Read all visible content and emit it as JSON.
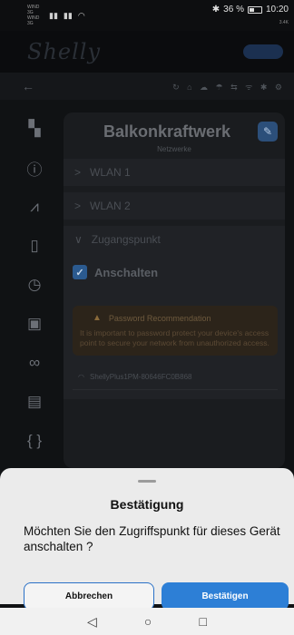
{
  "status_bar": {
    "carrier_line1": "WIND 3G",
    "carrier_line2": "WIND 3G",
    "signal1": "▮▮",
    "signal2": "▮▮",
    "wifi": "◠",
    "bluetooth": "✱",
    "battery_percent": "36 %",
    "time": "10:20",
    "sub_info": "3.4K"
  },
  "app": {
    "logo_text": "Shelly",
    "back_icon": "arrow-left-icon"
  },
  "subbar": {
    "back_glyph": "←",
    "icons_text": "↻ ⌂ ☁ ☂ ⇆ ᯤ ✱ ⚙"
  },
  "sidebar": {
    "items": [
      {
        "icon": "device-icon",
        "glyph": "▚"
      },
      {
        "icon": "info-icon",
        "glyph": "ⓘ"
      },
      {
        "icon": "chart-icon",
        "glyph": "⩘"
      },
      {
        "icon": "battery-icon",
        "glyph": "▯"
      },
      {
        "icon": "clock-icon",
        "glyph": "◷"
      },
      {
        "icon": "calendar-icon",
        "glyph": "▣"
      },
      {
        "icon": "link-icon",
        "glyph": "∞"
      },
      {
        "icon": "plugin-icon",
        "glyph": "▤"
      },
      {
        "icon": "code-icon",
        "glyph": "{ }"
      }
    ]
  },
  "content": {
    "title": "Balkonkraftwerk",
    "subtitle": "Netzwerke",
    "edit_glyph": "✎",
    "sections": [
      {
        "label": "WLAN 1",
        "chevron": ">"
      },
      {
        "label": "WLAN 2",
        "chevron": ">"
      }
    ],
    "open_section": {
      "label": "Zugangspunkt",
      "chevron": "∨",
      "toggle_label": "Anschalten",
      "toggle_glyph": "✓",
      "warning_title": "Password Recommendation",
      "warning_icon_glyph": "▲",
      "warning_text": "It is important to password protect your device's access point to secure your network from unauthorized access.",
      "ssid": "ShellyPlus1PM-80646FC0B868",
      "ssid_icon_glyph": "◠"
    }
  },
  "dialog": {
    "title": "Bestätigung",
    "message": "Möchten Sie den Zugriffspunkt für dieses Gerät anschalten ?",
    "cancel_label": "Abbrechen",
    "confirm_label": "Bestätigen"
  },
  "nav": {
    "back": "◁",
    "home": "○",
    "recents": "□"
  }
}
